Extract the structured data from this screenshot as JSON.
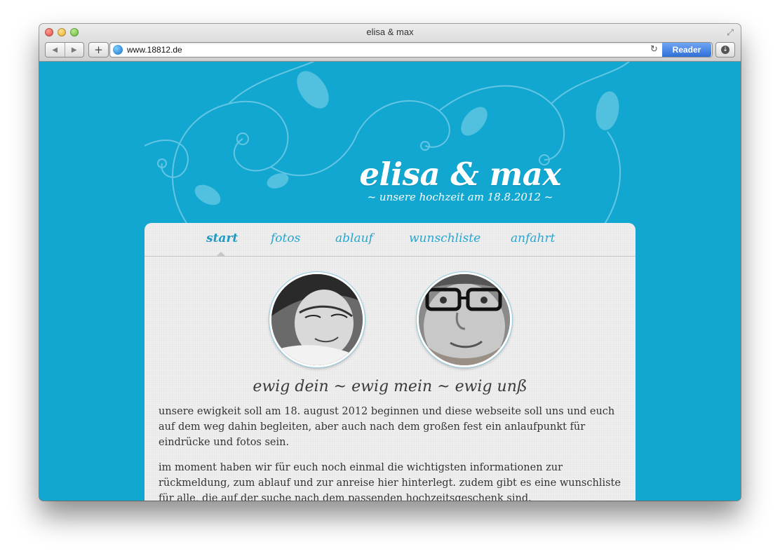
{
  "browser": {
    "window_title": "elisa & max",
    "url": "www.18812.de",
    "reader_label": "Reader",
    "back_glyph": "◀",
    "forward_glyph": "▶",
    "add_glyph": "+",
    "reload_glyph": "↻",
    "download_glyph": "↓",
    "fullscreen_glyph": "⤢"
  },
  "site": {
    "title": "elisa & max",
    "subtitle": "~ unsere hochzeit am 18.8.2012 ~",
    "nav": [
      {
        "label": "start",
        "active": true
      },
      {
        "label": "fotos",
        "active": false
      },
      {
        "label": "ablauf",
        "active": false
      },
      {
        "label": "wunschliste",
        "active": false
      },
      {
        "label": "anfahrt",
        "active": false
      }
    ],
    "headline": "ewig dein ~ ewig mein ~ ewig unß",
    "paragraphs": [
      "unsere ewigkeit soll am 18. august 2012 beginnen und diese webseite soll uns und euch auf dem weg dahin begleiten, aber auch nach dem großen fest ein anlaufpunkt für eindrücke und fotos sein.",
      "im moment haben wir für euch noch einmal die wichtigsten informationen zur rückmeldung, zum ablauf und zur anreise hier hinterlegt. zudem gibt es eine wunschliste für alle, die auf der suche nach dem passenden hochzeitsgeschenk sind."
    ]
  },
  "colors": {
    "page_background": "#11a7d0",
    "nav_link": "#27a6cf",
    "reader_button": "#3f7fe0"
  }
}
